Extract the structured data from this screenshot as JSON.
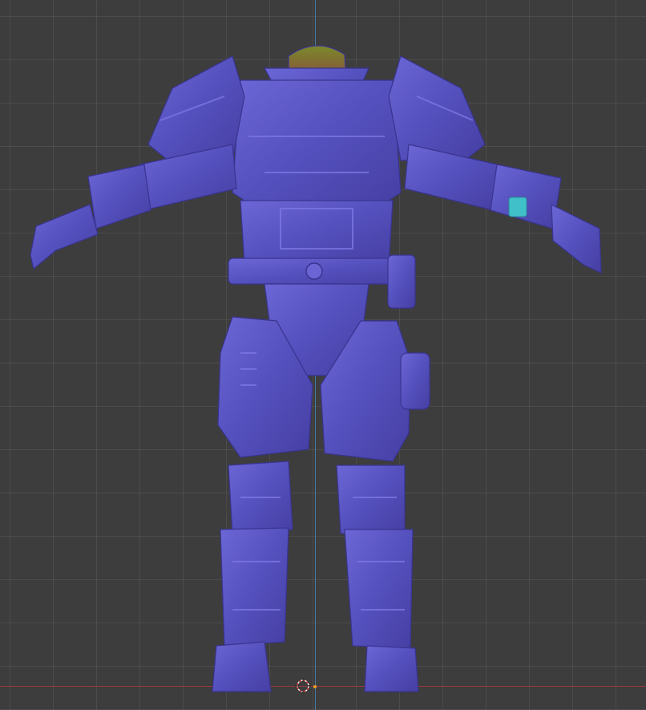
{
  "viewport": {
    "background": "#3d3d3d",
    "grid_color": "#4a4a4a",
    "axis_z_color": "#4a7fa8",
    "axis_x_color": "#9b3a3a",
    "cursor_icon": "3d-cursor-icon",
    "origin_icon": "object-origin-icon"
  },
  "model": {
    "armor_color": "#5b57c4",
    "armor_shade": "#4640a6",
    "armor_light": "#7670dc",
    "neck_color": "#6f7a2e",
    "visor_color": "#40c0c8"
  }
}
